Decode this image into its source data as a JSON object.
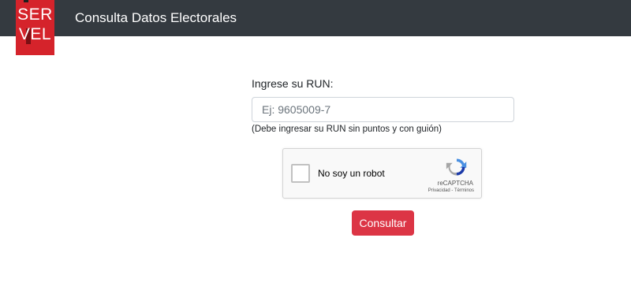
{
  "header": {
    "logo_line1": "SER",
    "logo_line2": "VEL",
    "title": "Consulta Datos Electorales"
  },
  "form": {
    "run_label": "Ingrese su RUN:",
    "run_placeholder": "Ej: 9605009-7",
    "run_value": "",
    "hint": "(Debe ingresar su RUN sin puntos y con guión)",
    "captcha": {
      "label": "No soy un robot",
      "brand": "reCAPTCHA",
      "links": "Privacidad - Términos",
      "checked": false
    },
    "submit_label": "Consultar"
  },
  "colors": {
    "header_bg": "#343a40",
    "logo_red": "#d5232b",
    "submit_red": "#dc3545"
  }
}
